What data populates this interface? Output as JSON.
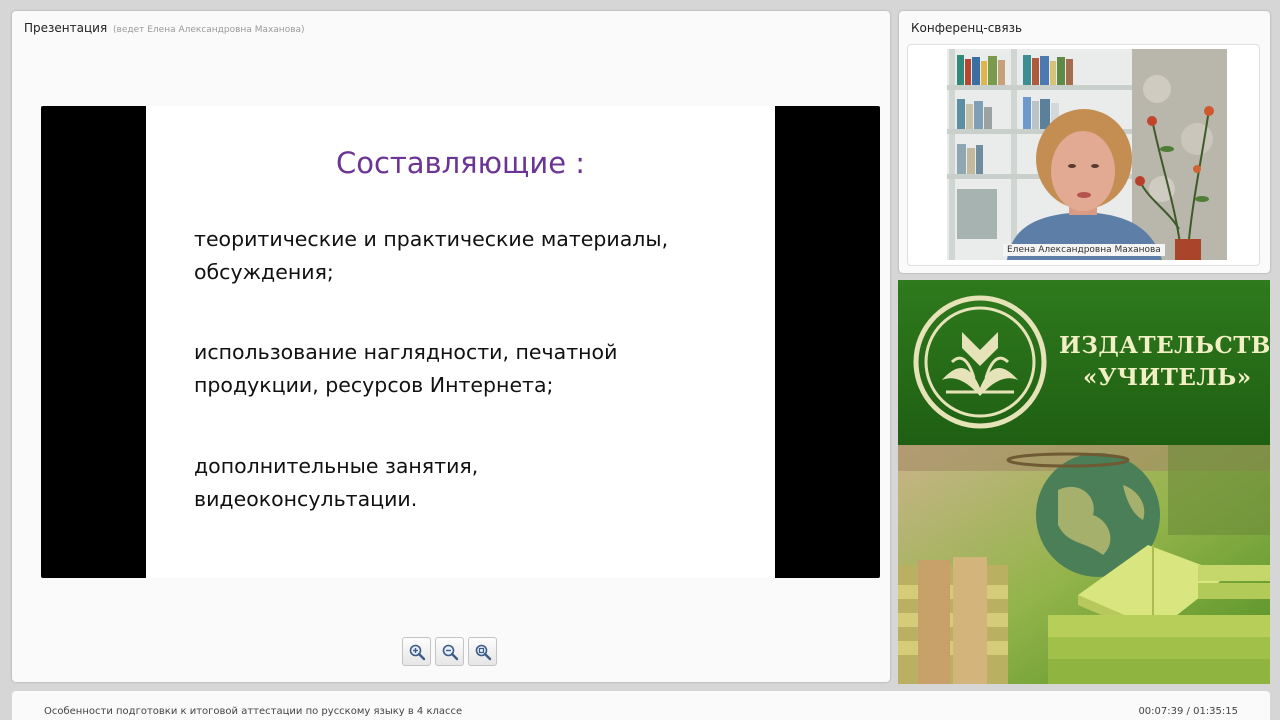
{
  "presentation": {
    "title": "Презентация",
    "presenter": "(ведет Елена Александровна Маханова)"
  },
  "slide": {
    "heading": "Составляющие :",
    "items": [
      "теоритические и практические материалы,\nобсуждения;",
      "использование наглядности, печатной\nпродукции, ресурсов Интернета;",
      " дополнительные занятия,\nвидеоконсультации."
    ]
  },
  "zoom_controls": {
    "icons": [
      "zoom-in-icon",
      "zoom-out-icon",
      "zoom-fit-icon"
    ]
  },
  "conference": {
    "title": "Конференц-связь",
    "participant_name": "Елена Александровна Маханова"
  },
  "banner": {
    "line1": "ИЗДАТЕЛЬСТВО",
    "line2": "«УЧИТЕЛЬ»"
  },
  "footer": {
    "lesson_title": "Особенности подготовки к итоговой аттестации по русскому языку в 4 классе",
    "time": "00:07:39 / 01:35:15"
  },
  "colors": {
    "slide_heading": "#6b3595",
    "banner_green": "#1f5f13",
    "banner_text": "#f3efc5"
  }
}
